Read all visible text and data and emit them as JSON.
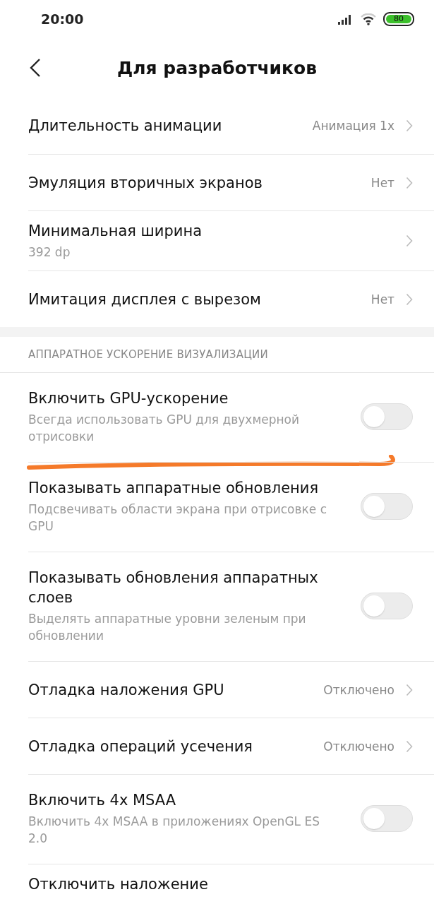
{
  "status_bar": {
    "time": "20:00",
    "battery": "80"
  },
  "header": {
    "title": "Для разработчиков"
  },
  "sections": [
    {
      "items": [
        {
          "kind": "value",
          "title": "Длительность анимации",
          "value": "Анимация 1x"
        },
        {
          "kind": "value",
          "title": "Эмуляция вторичных экранов",
          "value": "Нет"
        },
        {
          "kind": "nav",
          "title": "Минимальная ширина",
          "subtitle": "392 dp"
        },
        {
          "kind": "value",
          "title": "Имитация дисплея с вырезом",
          "value": "Нет"
        }
      ]
    },
    {
      "title": "АППАРАТНОЕ УСКОРЕНИЕ ВИЗУАЛИЗАЦИИ",
      "items": [
        {
          "kind": "toggle",
          "title": "Включить GPU-ускорение",
          "subtitle": "Всегда использовать GPU для двухмерной отрисовки",
          "on": false
        },
        {
          "kind": "toggle",
          "title": "Показывать аппаратные обновления",
          "subtitle": "Подсвечивать области экрана при отрисовке с GPU",
          "on": false
        },
        {
          "kind": "toggle",
          "title": "Показывать обновления аппаратных слоев",
          "subtitle": "Выделять аппаратные уровни зеленым при обновлении",
          "on": false
        },
        {
          "kind": "value",
          "title": "Отладка наложения GPU",
          "value": "Отключено"
        },
        {
          "kind": "value",
          "title": "Отладка операций усечения",
          "value": "Отключено"
        },
        {
          "kind": "toggle",
          "title": "Включить 4x MSAA",
          "subtitle": "Включить 4x MSAA в приложениях OpenGL ES 2.0",
          "on": false
        },
        {
          "kind": "plain",
          "title": "Отключить наложение"
        }
      ]
    }
  ]
}
